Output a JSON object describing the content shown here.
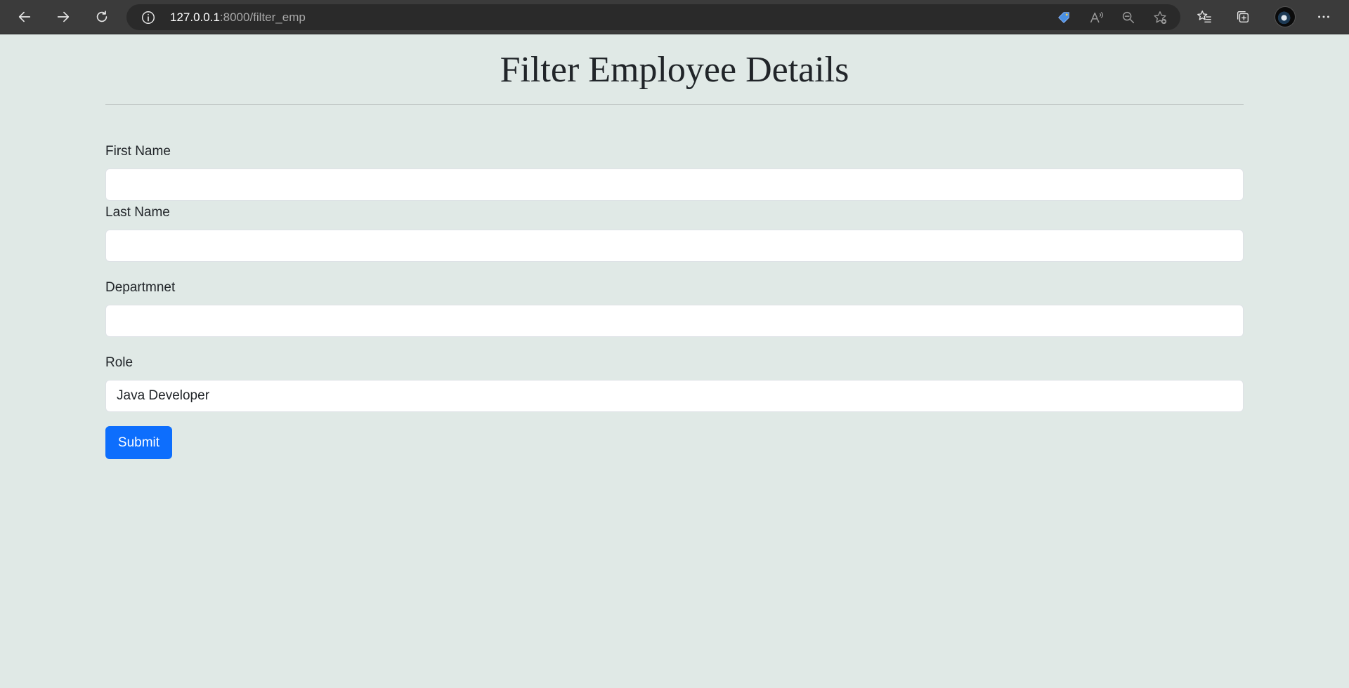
{
  "browser": {
    "url_host": "127.0.0.1",
    "url_rest": ":8000/filter_emp"
  },
  "page": {
    "title": "Filter Employee Details"
  },
  "form": {
    "first_name": {
      "label": "First Name",
      "value": ""
    },
    "last_name": {
      "label": "Last Name",
      "value": ""
    },
    "department": {
      "label": "Departmnet",
      "value": ""
    },
    "role": {
      "label": "Role",
      "value": "Java Developer"
    },
    "submit_label": "Submit"
  },
  "icons": {
    "back": "back-arrow-icon",
    "forward": "forward-arrow-icon",
    "refresh": "refresh-icon",
    "site_info": "info-icon",
    "shopping": "tag-icon",
    "read_aloud": "read-aloud-icon",
    "zoom": "zoom-out-icon",
    "add_favorite": "add-favorite-icon",
    "favorites": "favorites-icon",
    "collections": "collections-icon",
    "profile": "avatar",
    "more": "more-icon"
  },
  "colors": {
    "page_background": "#e0e9e6",
    "toolbar_background": "#3b3b3b",
    "primary_button": "#0d6efd",
    "text": "#212529"
  }
}
